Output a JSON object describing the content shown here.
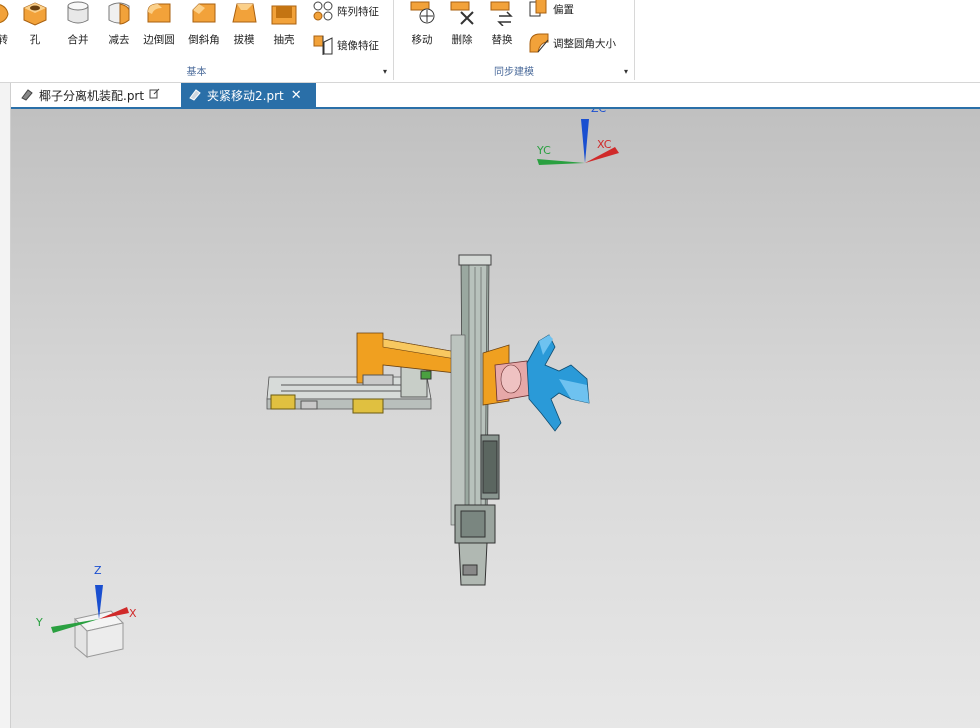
{
  "ribbon": {
    "groups": {
      "basic": {
        "label": "基本"
      },
      "sync": {
        "label": "同步建模"
      }
    },
    "tools": {
      "rotate_partial": "转",
      "hole": "孔",
      "unite": "合并",
      "subtract": "减去",
      "edge_blend": "边倒圆",
      "chamfer": "倒斜角",
      "draft": "拔模",
      "shell": "抽壳",
      "pattern_feature": "阵列特征",
      "mirror_feature": "镜像特征",
      "move": "移动",
      "delete": "删除",
      "replace": "替换",
      "offset": "偏置",
      "resize_blend": "调整圆角大小"
    }
  },
  "tabs": [
    {
      "label": "椰子分离机装配.prt",
      "active": false
    },
    {
      "label": "夹紧移动2.prt",
      "active": true
    }
  ],
  "viewport": {
    "triad_top": {
      "z": "ZC",
      "y": "YC",
      "x": "XC"
    },
    "triad_bottom": {
      "z": "Z",
      "y": "Y",
      "x": "X"
    }
  },
  "colors": {
    "accent": "#2a6fa8",
    "orange_part": "#f0a020",
    "cyan_gripper": "#2a9ad8",
    "pink_part": "#e6a8a8",
    "gray_rail": "#9aa8a0"
  }
}
